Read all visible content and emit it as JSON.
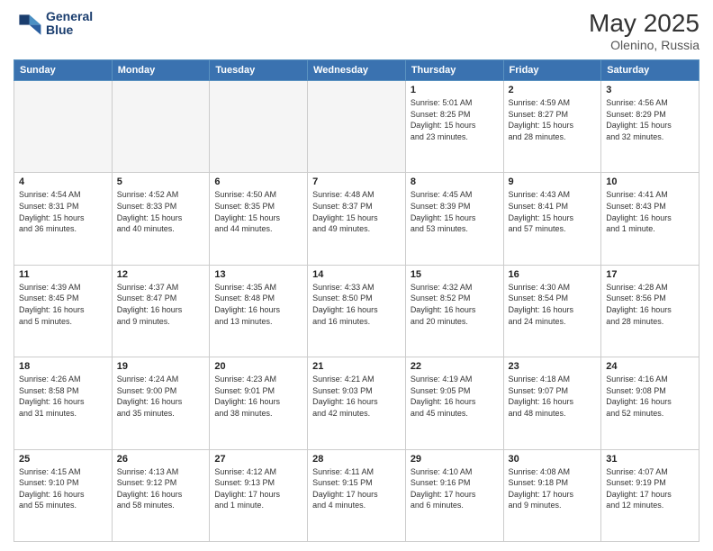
{
  "header": {
    "logo_line1": "General",
    "logo_line2": "Blue",
    "title": "May 2025",
    "subtitle": "Olenino, Russia"
  },
  "days_of_week": [
    "Sunday",
    "Monday",
    "Tuesday",
    "Wednesday",
    "Thursday",
    "Friday",
    "Saturday"
  ],
  "weeks": [
    [
      {
        "day": "",
        "info": ""
      },
      {
        "day": "",
        "info": ""
      },
      {
        "day": "",
        "info": ""
      },
      {
        "day": "",
        "info": ""
      },
      {
        "day": "1",
        "info": "Sunrise: 5:01 AM\nSunset: 8:25 PM\nDaylight: 15 hours\nand 23 minutes."
      },
      {
        "day": "2",
        "info": "Sunrise: 4:59 AM\nSunset: 8:27 PM\nDaylight: 15 hours\nand 28 minutes."
      },
      {
        "day": "3",
        "info": "Sunrise: 4:56 AM\nSunset: 8:29 PM\nDaylight: 15 hours\nand 32 minutes."
      }
    ],
    [
      {
        "day": "4",
        "info": "Sunrise: 4:54 AM\nSunset: 8:31 PM\nDaylight: 15 hours\nand 36 minutes."
      },
      {
        "day": "5",
        "info": "Sunrise: 4:52 AM\nSunset: 8:33 PM\nDaylight: 15 hours\nand 40 minutes."
      },
      {
        "day": "6",
        "info": "Sunrise: 4:50 AM\nSunset: 8:35 PM\nDaylight: 15 hours\nand 44 minutes."
      },
      {
        "day": "7",
        "info": "Sunrise: 4:48 AM\nSunset: 8:37 PM\nDaylight: 15 hours\nand 49 minutes."
      },
      {
        "day": "8",
        "info": "Sunrise: 4:45 AM\nSunset: 8:39 PM\nDaylight: 15 hours\nand 53 minutes."
      },
      {
        "day": "9",
        "info": "Sunrise: 4:43 AM\nSunset: 8:41 PM\nDaylight: 15 hours\nand 57 minutes."
      },
      {
        "day": "10",
        "info": "Sunrise: 4:41 AM\nSunset: 8:43 PM\nDaylight: 16 hours\nand 1 minute."
      }
    ],
    [
      {
        "day": "11",
        "info": "Sunrise: 4:39 AM\nSunset: 8:45 PM\nDaylight: 16 hours\nand 5 minutes."
      },
      {
        "day": "12",
        "info": "Sunrise: 4:37 AM\nSunset: 8:47 PM\nDaylight: 16 hours\nand 9 minutes."
      },
      {
        "day": "13",
        "info": "Sunrise: 4:35 AM\nSunset: 8:48 PM\nDaylight: 16 hours\nand 13 minutes."
      },
      {
        "day": "14",
        "info": "Sunrise: 4:33 AM\nSunset: 8:50 PM\nDaylight: 16 hours\nand 16 minutes."
      },
      {
        "day": "15",
        "info": "Sunrise: 4:32 AM\nSunset: 8:52 PM\nDaylight: 16 hours\nand 20 minutes."
      },
      {
        "day": "16",
        "info": "Sunrise: 4:30 AM\nSunset: 8:54 PM\nDaylight: 16 hours\nand 24 minutes."
      },
      {
        "day": "17",
        "info": "Sunrise: 4:28 AM\nSunset: 8:56 PM\nDaylight: 16 hours\nand 28 minutes."
      }
    ],
    [
      {
        "day": "18",
        "info": "Sunrise: 4:26 AM\nSunset: 8:58 PM\nDaylight: 16 hours\nand 31 minutes."
      },
      {
        "day": "19",
        "info": "Sunrise: 4:24 AM\nSunset: 9:00 PM\nDaylight: 16 hours\nand 35 minutes."
      },
      {
        "day": "20",
        "info": "Sunrise: 4:23 AM\nSunset: 9:01 PM\nDaylight: 16 hours\nand 38 minutes."
      },
      {
        "day": "21",
        "info": "Sunrise: 4:21 AM\nSunset: 9:03 PM\nDaylight: 16 hours\nand 42 minutes."
      },
      {
        "day": "22",
        "info": "Sunrise: 4:19 AM\nSunset: 9:05 PM\nDaylight: 16 hours\nand 45 minutes."
      },
      {
        "day": "23",
        "info": "Sunrise: 4:18 AM\nSunset: 9:07 PM\nDaylight: 16 hours\nand 48 minutes."
      },
      {
        "day": "24",
        "info": "Sunrise: 4:16 AM\nSunset: 9:08 PM\nDaylight: 16 hours\nand 52 minutes."
      }
    ],
    [
      {
        "day": "25",
        "info": "Sunrise: 4:15 AM\nSunset: 9:10 PM\nDaylight: 16 hours\nand 55 minutes."
      },
      {
        "day": "26",
        "info": "Sunrise: 4:13 AM\nSunset: 9:12 PM\nDaylight: 16 hours\nand 58 minutes."
      },
      {
        "day": "27",
        "info": "Sunrise: 4:12 AM\nSunset: 9:13 PM\nDaylight: 17 hours\nand 1 minute."
      },
      {
        "day": "28",
        "info": "Sunrise: 4:11 AM\nSunset: 9:15 PM\nDaylight: 17 hours\nand 4 minutes."
      },
      {
        "day": "29",
        "info": "Sunrise: 4:10 AM\nSunset: 9:16 PM\nDaylight: 17 hours\nand 6 minutes."
      },
      {
        "day": "30",
        "info": "Sunrise: 4:08 AM\nSunset: 9:18 PM\nDaylight: 17 hours\nand 9 minutes."
      },
      {
        "day": "31",
        "info": "Sunrise: 4:07 AM\nSunset: 9:19 PM\nDaylight: 17 hours\nand 12 minutes."
      }
    ]
  ]
}
